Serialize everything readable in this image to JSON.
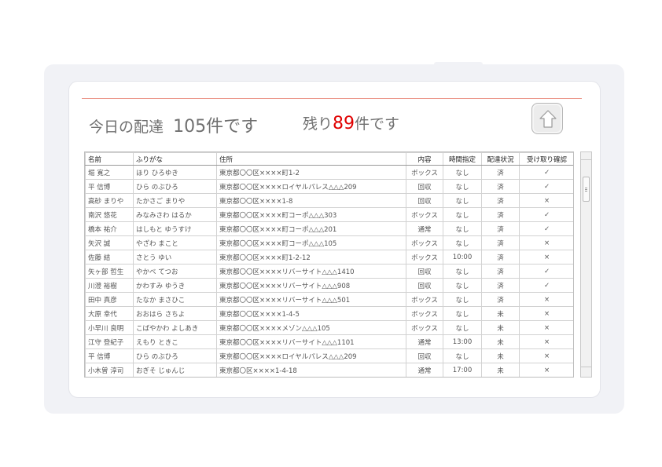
{
  "header": {
    "today_label": "今日の配達",
    "today_count": "105件です",
    "remaining_label": "残り",
    "remaining_count": "89",
    "remaining_suffix": "件です",
    "home_icon": "home-icon"
  },
  "table": {
    "columns": [
      "名前",
      "ふりがな",
      "住所",
      "内容",
      "時間指定",
      "配達状況",
      "受け取り確認"
    ],
    "rows": [
      [
        "堀 寛之",
        "ほり ひろゆき",
        "東京都〇〇区××××町1-2",
        "ボックス",
        "なし",
        "済",
        "✓"
      ],
      [
        "平 信博",
        "ひら のぶひろ",
        "東京都〇〇区××××ロイヤルパレス△△△209",
        "回収",
        "なし",
        "済",
        "✓"
      ],
      [
        "高砂 まりや",
        "たかさご まりや",
        "東京都〇〇区××××1-8",
        "回収",
        "なし",
        "済",
        "×"
      ],
      [
        "南沢 悠花",
        "みなみさわ はるか",
        "東京都〇〇区××××町コーポ△△△303",
        "ボックス",
        "なし",
        "済",
        "✓"
      ],
      [
        "橋本 祐介",
        "はしもと ゆうすけ",
        "東京都〇〇区××××町コーポ△△△201",
        "通常",
        "なし",
        "済",
        "✓"
      ],
      [
        "矢沢 誠",
        "やざわ まこと",
        "東京都〇〇区××××町コーポ△△△105",
        "ボックス",
        "なし",
        "済",
        "×"
      ],
      [
        "佐藤 結",
        "さとう ゆい",
        "東京都〇〇区××××町1-2-12",
        "ボックス",
        "10:00",
        "済",
        "×"
      ],
      [
        "矢ヶ部 哲生",
        "やかべ てつお",
        "東京都〇〇区××××リバーサイト△△△1410",
        "回収",
        "なし",
        "済",
        "✓"
      ],
      [
        "川澄 裕樹",
        "かわすみ ゆうき",
        "東京都〇〇区××××リバーサイト△△△908",
        "回収",
        "なし",
        "済",
        "✓"
      ],
      [
        "田中 真彦",
        "たなか まさひこ",
        "東京都〇〇区××××リバーサイト△△△501",
        "ボックス",
        "なし",
        "済",
        "×"
      ],
      [
        "大原 幸代",
        "おおはら さちよ",
        "東京都〇〇区××××1-4-5",
        "ボックス",
        "なし",
        "未",
        "×"
      ],
      [
        "小早川 良明",
        "こばやかわ よしあき",
        "東京都〇〇区××××メゾン△△△105",
        "ボックス",
        "なし",
        "未",
        "×"
      ],
      [
        "江守 登紀子",
        "えもり ときこ",
        "東京都〇〇区××××リバーサイト△△△1101",
        "通常",
        "13:00",
        "未",
        "×"
      ],
      [
        "平 信博",
        "ひら のぶひろ",
        "東京都〇〇区××××ロイヤルパレス△△△209",
        "回収",
        "なし",
        "未",
        "×"
      ],
      [
        "小木曽 淳司",
        "おぎそ じゅんじ",
        "東京都〇区××××1-4-18",
        "通常",
        "17:00",
        "未",
        "×"
      ]
    ]
  }
}
